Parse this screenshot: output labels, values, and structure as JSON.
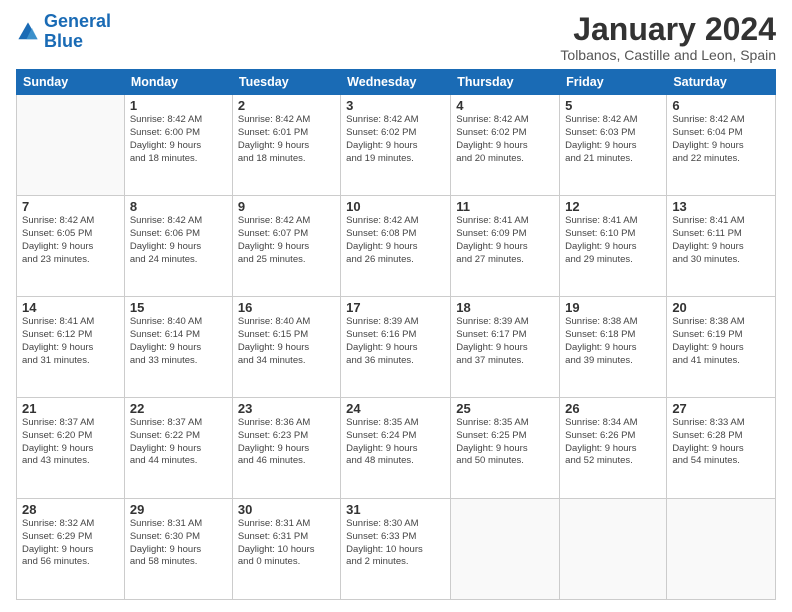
{
  "logo": {
    "line1": "General",
    "line2": "Blue"
  },
  "title": "January 2024",
  "subtitle": "Tolbanos, Castille and Leon, Spain",
  "weekdays": [
    "Sunday",
    "Monday",
    "Tuesday",
    "Wednesday",
    "Thursday",
    "Friday",
    "Saturday"
  ],
  "weeks": [
    [
      {
        "day": "",
        "info": ""
      },
      {
        "day": "1",
        "info": "Sunrise: 8:42 AM\nSunset: 6:00 PM\nDaylight: 9 hours\nand 18 minutes."
      },
      {
        "day": "2",
        "info": "Sunrise: 8:42 AM\nSunset: 6:01 PM\nDaylight: 9 hours\nand 18 minutes."
      },
      {
        "day": "3",
        "info": "Sunrise: 8:42 AM\nSunset: 6:02 PM\nDaylight: 9 hours\nand 19 minutes."
      },
      {
        "day": "4",
        "info": "Sunrise: 8:42 AM\nSunset: 6:02 PM\nDaylight: 9 hours\nand 20 minutes."
      },
      {
        "day": "5",
        "info": "Sunrise: 8:42 AM\nSunset: 6:03 PM\nDaylight: 9 hours\nand 21 minutes."
      },
      {
        "day": "6",
        "info": "Sunrise: 8:42 AM\nSunset: 6:04 PM\nDaylight: 9 hours\nand 22 minutes."
      }
    ],
    [
      {
        "day": "7",
        "info": "Sunrise: 8:42 AM\nSunset: 6:05 PM\nDaylight: 9 hours\nand 23 minutes."
      },
      {
        "day": "8",
        "info": "Sunrise: 8:42 AM\nSunset: 6:06 PM\nDaylight: 9 hours\nand 24 minutes."
      },
      {
        "day": "9",
        "info": "Sunrise: 8:42 AM\nSunset: 6:07 PM\nDaylight: 9 hours\nand 25 minutes."
      },
      {
        "day": "10",
        "info": "Sunrise: 8:42 AM\nSunset: 6:08 PM\nDaylight: 9 hours\nand 26 minutes."
      },
      {
        "day": "11",
        "info": "Sunrise: 8:41 AM\nSunset: 6:09 PM\nDaylight: 9 hours\nand 27 minutes."
      },
      {
        "day": "12",
        "info": "Sunrise: 8:41 AM\nSunset: 6:10 PM\nDaylight: 9 hours\nand 29 minutes."
      },
      {
        "day": "13",
        "info": "Sunrise: 8:41 AM\nSunset: 6:11 PM\nDaylight: 9 hours\nand 30 minutes."
      }
    ],
    [
      {
        "day": "14",
        "info": "Sunrise: 8:41 AM\nSunset: 6:12 PM\nDaylight: 9 hours\nand 31 minutes."
      },
      {
        "day": "15",
        "info": "Sunrise: 8:40 AM\nSunset: 6:14 PM\nDaylight: 9 hours\nand 33 minutes."
      },
      {
        "day": "16",
        "info": "Sunrise: 8:40 AM\nSunset: 6:15 PM\nDaylight: 9 hours\nand 34 minutes."
      },
      {
        "day": "17",
        "info": "Sunrise: 8:39 AM\nSunset: 6:16 PM\nDaylight: 9 hours\nand 36 minutes."
      },
      {
        "day": "18",
        "info": "Sunrise: 8:39 AM\nSunset: 6:17 PM\nDaylight: 9 hours\nand 37 minutes."
      },
      {
        "day": "19",
        "info": "Sunrise: 8:38 AM\nSunset: 6:18 PM\nDaylight: 9 hours\nand 39 minutes."
      },
      {
        "day": "20",
        "info": "Sunrise: 8:38 AM\nSunset: 6:19 PM\nDaylight: 9 hours\nand 41 minutes."
      }
    ],
    [
      {
        "day": "21",
        "info": "Sunrise: 8:37 AM\nSunset: 6:20 PM\nDaylight: 9 hours\nand 43 minutes."
      },
      {
        "day": "22",
        "info": "Sunrise: 8:37 AM\nSunset: 6:22 PM\nDaylight: 9 hours\nand 44 minutes."
      },
      {
        "day": "23",
        "info": "Sunrise: 8:36 AM\nSunset: 6:23 PM\nDaylight: 9 hours\nand 46 minutes."
      },
      {
        "day": "24",
        "info": "Sunrise: 8:35 AM\nSunset: 6:24 PM\nDaylight: 9 hours\nand 48 minutes."
      },
      {
        "day": "25",
        "info": "Sunrise: 8:35 AM\nSunset: 6:25 PM\nDaylight: 9 hours\nand 50 minutes."
      },
      {
        "day": "26",
        "info": "Sunrise: 8:34 AM\nSunset: 6:26 PM\nDaylight: 9 hours\nand 52 minutes."
      },
      {
        "day": "27",
        "info": "Sunrise: 8:33 AM\nSunset: 6:28 PM\nDaylight: 9 hours\nand 54 minutes."
      }
    ],
    [
      {
        "day": "28",
        "info": "Sunrise: 8:32 AM\nSunset: 6:29 PM\nDaylight: 9 hours\nand 56 minutes."
      },
      {
        "day": "29",
        "info": "Sunrise: 8:31 AM\nSunset: 6:30 PM\nDaylight: 9 hours\nand 58 minutes."
      },
      {
        "day": "30",
        "info": "Sunrise: 8:31 AM\nSunset: 6:31 PM\nDaylight: 10 hours\nand 0 minutes."
      },
      {
        "day": "31",
        "info": "Sunrise: 8:30 AM\nSunset: 6:33 PM\nDaylight: 10 hours\nand 2 minutes."
      },
      {
        "day": "",
        "info": ""
      },
      {
        "day": "",
        "info": ""
      },
      {
        "day": "",
        "info": ""
      }
    ]
  ]
}
